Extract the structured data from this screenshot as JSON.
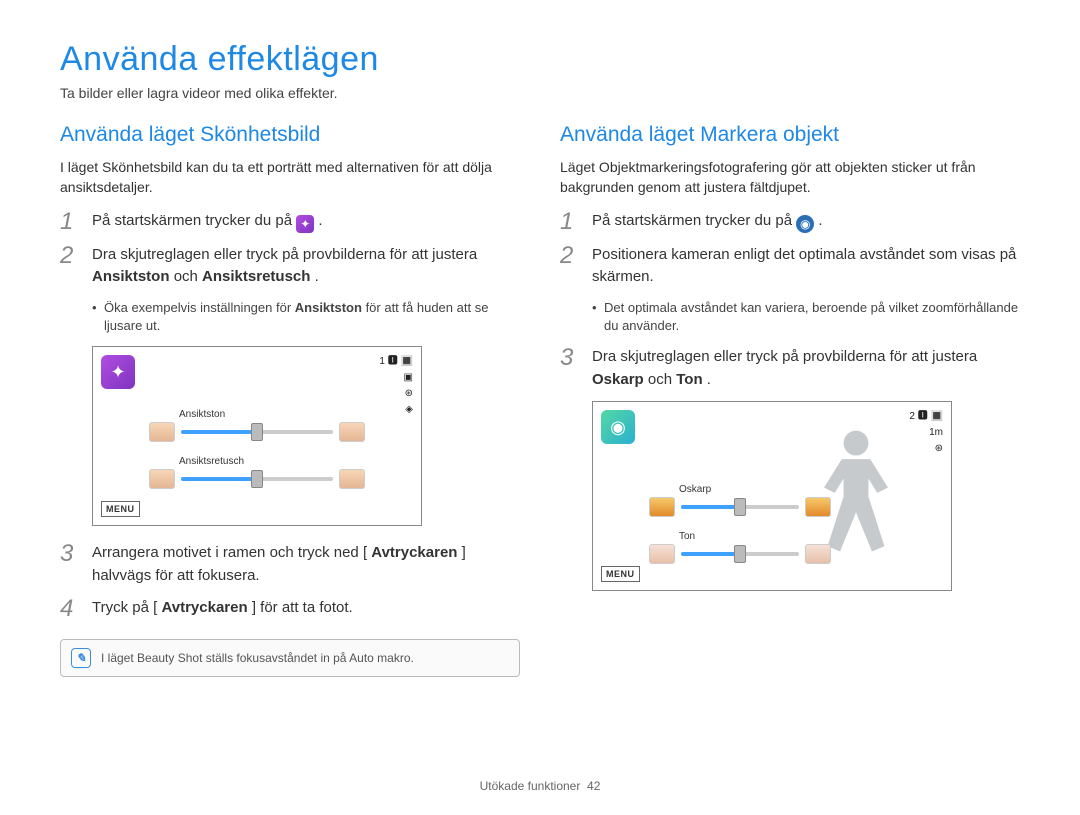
{
  "page": {
    "title": "Använda effektlägen",
    "subtitle": "Ta bilder eller lagra videor med olika effekter."
  },
  "left": {
    "heading": "Använda läget Skönhetsbild",
    "intro": "I läget Skönhetsbild kan du ta ett porträtt med alternativen för att dölja ansiktsdetaljer.",
    "step1_prefix": "På startskärmen trycker du på ",
    "step1_suffix": ".",
    "step2_pre": "Dra skjutreglagen eller tryck på provbilderna för att justera ",
    "step2_bold1": "Ansiktston",
    "step2_mid": " och ",
    "step2_bold2": "Ansiktsretusch",
    "step2_end": ".",
    "bullet_pre": "Öka exempelvis inställningen för ",
    "bullet_bold": "Ansiktston",
    "bullet_post": " för att få huden att se ljusare ut.",
    "slider1_label": "Ansiktston",
    "slider2_label": "Ansiktsretusch",
    "menu_label": "MENU",
    "status_count": "1",
    "step3_pre": "Arrangera motivet i ramen och tryck ned [",
    "step3_bold": "Avtryckaren",
    "step3_post": "] halvvägs för att fokusera.",
    "step4_pre": "Tryck på [",
    "step4_bold": "Avtryckaren",
    "step4_post": "] för att ta fotot.",
    "note": "I läget Beauty Shot ställs fokusavståndet in på Auto makro."
  },
  "right": {
    "heading": "Använda läget Markera objekt",
    "intro": "Läget Objektmarkeringsfotografering gör att objekten sticker ut från bakgrunden genom att justera fältdjupet.",
    "step1_prefix": "På startskärmen trycker du på ",
    "step1_suffix": ".",
    "step2": "Positionera kameran enligt det optimala avståndet som visas på skärmen.",
    "bullet": "Det optimala avståndet kan variera, beroende på vilket zoomförhållande du använder.",
    "step3_pre": "Dra skjutreglagen eller tryck på provbilderna för att justera ",
    "step3_bold1": "Oskarp",
    "step3_mid": " och ",
    "step3_bold2": "Ton",
    "step3_end": ".",
    "slider1_label": "Oskarp",
    "slider2_label": "Ton",
    "menu_label": "MENU",
    "status_count": "2",
    "status_dist": "1m"
  },
  "footer": {
    "section": "Utökade funktioner",
    "page_num": "42"
  }
}
